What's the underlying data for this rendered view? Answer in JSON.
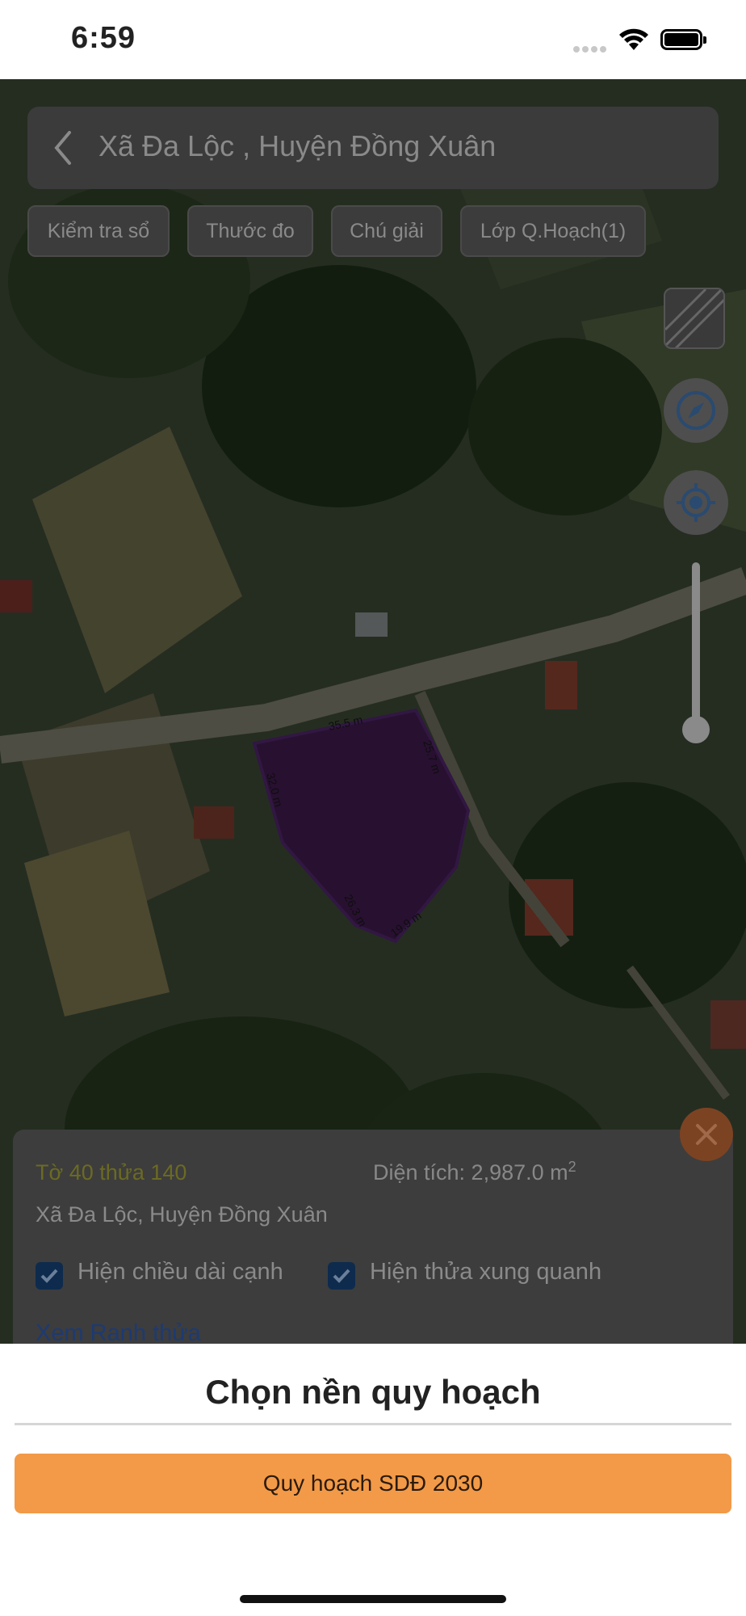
{
  "status_bar": {
    "time": "6:59"
  },
  "search": {
    "location_text": "Xã Đa Lộc , Huyện Đồng Xuân"
  },
  "toolbar_chips": [
    {
      "label": "Kiểm tra sổ"
    },
    {
      "label": "Thước đo"
    },
    {
      "label": "Chú giải"
    },
    {
      "label": "Lớp Q.Hoạch(1)"
    }
  ],
  "map": {
    "edge_labels": [
      "35.5 m",
      "25.7 m",
      "32.0 m",
      "26.3 m",
      "19.9 m"
    ],
    "parcel_color": "#4a1e5a"
  },
  "parcel_info": {
    "title": "Tờ 40 thửa 140",
    "area_label": "Diện tích: 2,987.0 m",
    "area_unit_sup": "2",
    "location": "Xã Đa Lộc, Huyện Đồng Xuân",
    "show_edge_lengths": {
      "label": "Hiện chiều dài cạnh",
      "checked": true
    },
    "show_neighbors": {
      "label": "Hiện thửa xung quanh",
      "checked": true
    },
    "view_boundary_link": "Xem Ranh thửa"
  },
  "sheet": {
    "title": "Chọn nền quy hoạch",
    "options": [
      {
        "label": "Quy hoạch SDĐ 2030"
      }
    ],
    "accent_color": "#f29a48"
  }
}
